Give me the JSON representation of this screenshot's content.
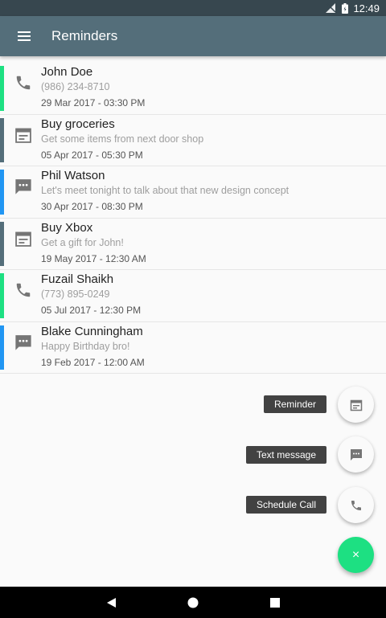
{
  "status_bar": {
    "time": "12:49"
  },
  "app_bar": {
    "title": "Reminders"
  },
  "colors": {
    "call": "#1de082",
    "reminder": "#546e7a",
    "message": "#2196f3"
  },
  "reminders": [
    {
      "type": "call",
      "icon": "phone-icon",
      "title": "John Doe",
      "subtitle": "(986) 234-8710",
      "datetime": "29 Mar 2017 - 03:30 PM"
    },
    {
      "type": "reminder",
      "icon": "calendar-icon",
      "title": "Buy groceries",
      "subtitle": "Get some items from next door shop",
      "datetime": "05 Apr 2017 - 05:30 PM"
    },
    {
      "type": "message",
      "icon": "message-icon",
      "title": "Phil Watson",
      "subtitle": "Let's meet tonight to talk about that new design concept",
      "datetime": "30 Apr 2017 - 08:30 PM"
    },
    {
      "type": "reminder",
      "icon": "calendar-icon",
      "title": "Buy Xbox",
      "subtitle": "Get a gift for John!",
      "datetime": "19 May 2017 - 12:30 AM"
    },
    {
      "type": "call",
      "icon": "phone-icon",
      "title": "Fuzail Shaikh",
      "subtitle": "(773) 895-0249",
      "datetime": "05 Jul 2017 - 12:30 PM"
    },
    {
      "type": "message",
      "icon": "message-icon",
      "title": "Blake Cunningham",
      "subtitle": "Happy Birthday bro!",
      "datetime": "19 Feb 2017 - 12:00 AM"
    }
  ],
  "fab_menu": {
    "reminder_label": "Reminder",
    "text_message_label": "Text message",
    "schedule_call_label": "Schedule Call",
    "close_icon": "×"
  }
}
